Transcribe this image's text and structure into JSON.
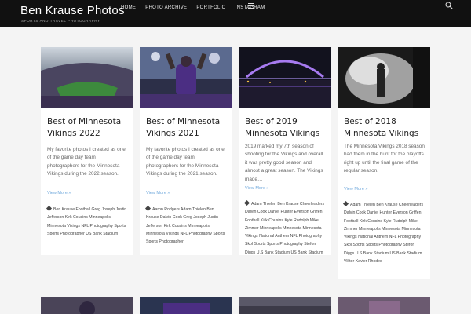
{
  "site": {
    "title": "Ben Krause Photos",
    "tagline": "SPORTS AND TRAVEL PHOTOGRAPHY"
  },
  "nav": {
    "items": [
      "HOME",
      "PHOTO ARCHIVE",
      "PORTFOLIO",
      "INSTAGRAM"
    ]
  },
  "icons": {
    "menu": "hamburger-menu-icon",
    "search": "search-icon",
    "tag": "tag-icon"
  },
  "colors": {
    "topbar": "#111111",
    "link": "#6fa8dc"
  },
  "posts": [
    {
      "title": "Best of Minnesota Vikings 2022",
      "excerpt": "My favorite photos I created as one of the game day team photographers for the Minnesota Vikings during the 2022 season.",
      "more": "View More »",
      "tags": "Ben Krause Football Greg Joseph Justin Jefferson Kirk Cousins Minneapolis Minnesota Vikings NFL Photography Sports Sports Photographer US Bank Stadium"
    },
    {
      "title": "Best of Minnesota Vikings 2021",
      "excerpt": "My favorite photos I created as one of the game day team photographers for the Minnesota Vikings during the 2021 season.",
      "more": "View More »",
      "tags": "Aaron Rodgers Adam Thielen Ben Krause Dalvin Cook Greg Joseph Justin Jefferson Kirk Cousins Minneapolis Minnesota Vikings NFL Photography Sports Sports Photographer"
    },
    {
      "title": "Best of 2019 Minnesota Vikings",
      "excerpt": "2019 marked my 7th season of shooting for the Vikings and overall it was pretty good season and almost a great season. The Vikings made…",
      "more": "View More »",
      "tags": "Adam Thielen Ben Krause Cheerleaders Dalvin Cook Daniel Hunter Everson Griffen Football Kirk Cousins Kyle Rudolph Mike Zimmer Minneapolis Minnesota Minnesota Vikings National Anthem NFL Photography Skol Sports Sports Photography Stefon Diggs U.S Bank Stadium US Bank Stadium"
    },
    {
      "title": "Best of 2018 Minnesota Vikings",
      "excerpt": "The Minnesota Vikings 2018 season had them in the hunt for the playoffs right up until the final game of the regular season.",
      "more": "View More »",
      "tags": "Adam Thielen Ben Krause Cheerleaders Dalvin Cook Daniel Hunter Everson Griffen Football Kirk Cousins Kyle Rudolph Mike Zimmer Minneapolis Minnesota Minnesota Vikings National Anthem NFL Photography Skol Sports Sports Photography Stefon Diggs U.S Bank Stadium US Bank Stadium Viktor Xavier Rhodes"
    }
  ]
}
